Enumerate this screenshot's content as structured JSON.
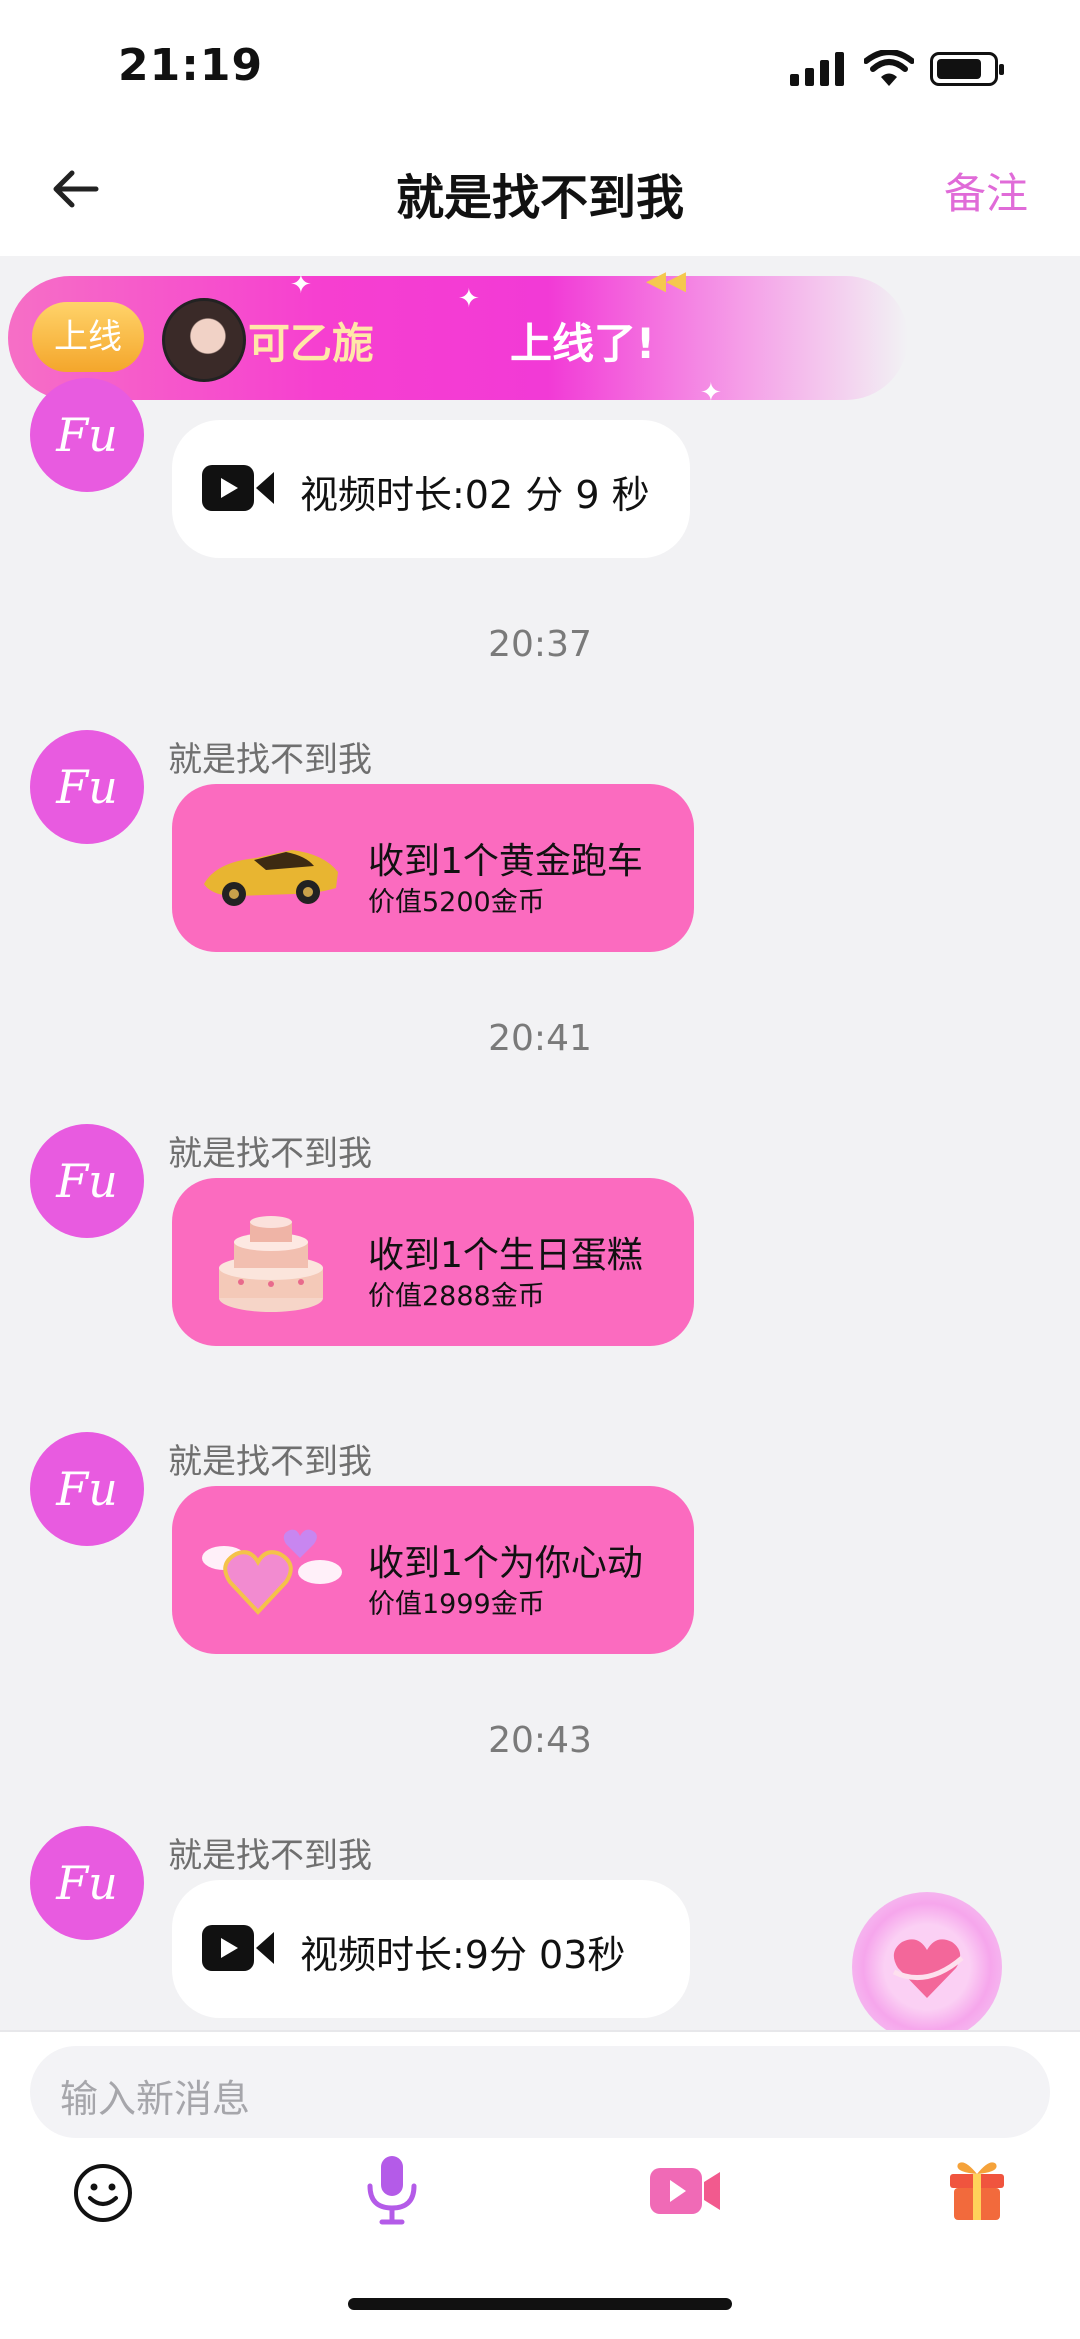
{
  "status": {
    "time": "21:19"
  },
  "nav": {
    "back_icon": "arrow-left-icon",
    "title": "就是找不到我",
    "remark_label": "备注"
  },
  "banner": {
    "pill": "上线",
    "name": "可乙旎",
    "text": "上线了!"
  },
  "messages": [
    {
      "type": "video",
      "text": "视频时长:02 分 9 秒"
    },
    {
      "type": "time",
      "text": "20:37"
    },
    {
      "type": "gift",
      "sender": "就是找不到我",
      "title": "收到1个黄金跑车",
      "sub": "价值5200金币",
      "icon": "gold-sports-car-icon"
    },
    {
      "type": "time",
      "text": "20:41"
    },
    {
      "type": "gift",
      "sender": "就是找不到我",
      "title": "收到1个生日蛋糕",
      "sub": "价值2888金币",
      "icon": "birthday-cake-icon"
    },
    {
      "type": "gift",
      "sender": "就是找不到我",
      "title": "收到1个为你心动",
      "sub": "价值1999金币",
      "icon": "winged-heart-icon"
    },
    {
      "type": "time",
      "text": "20:43"
    },
    {
      "type": "video",
      "sender": "就是找不到我",
      "text": "视频时长:9分 03秒"
    }
  ],
  "avatar_text": "Fu",
  "input": {
    "placeholder": "输入新消息"
  },
  "toolbar": [
    "emoji-icon",
    "microphone-icon",
    "video-call-icon",
    "gift-icon"
  ],
  "colors": {
    "accent": "#fb6bbf",
    "avatar": "#e85be0",
    "remark": "#e06bd8"
  }
}
